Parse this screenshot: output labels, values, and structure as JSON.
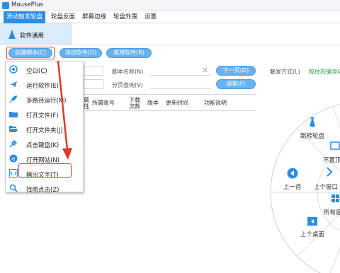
{
  "window": {
    "title": "MousePlus"
  },
  "menu": {
    "tabs": [
      {
        "label": "滑动触发轮盘"
      },
      {
        "label": "轮盘反面"
      },
      {
        "label": "屏幕边缘"
      },
      {
        "label": "轮盘外围"
      },
      {
        "label": "设置"
      }
    ]
  },
  "subnav": {
    "label": "软件通用"
  },
  "toolbar": {
    "create_label": "创建脚本(C)",
    "add_label": "添加软件(G)",
    "disable_label": "禁用软件(R)"
  },
  "filters": {
    "script_name_label": "脚本名称(N)",
    "page_query_label": "分页查询(V)",
    "next_page_label": "下一页(D)",
    "search_label": "搜索(F)",
    "trigger_label": "触发方式(L)",
    "trigger_value": "按住右键滑动"
  },
  "table": {
    "columns": [
      "属性",
      "所属账号",
      "下载次数",
      "版本",
      "更新时间",
      "功能说明"
    ]
  },
  "context_menu": {
    "items": [
      {
        "label": "空白(C)",
        "icon": "circle-dot-icon"
      },
      {
        "label": "运行软件(E)",
        "icon": "airplane-icon"
      },
      {
        "label": "多路径运行(M)",
        "icon": "rocket-icon"
      },
      {
        "label": "打开文件(F)",
        "icon": "folder-icon"
      },
      {
        "label": "打开文件夹(J)",
        "icon": "folder-open-icon"
      },
      {
        "label": "点击键盘(K)",
        "icon": "keyboard-icon"
      },
      {
        "label": "打开网站(N)",
        "icon": "ie-icon"
      },
      {
        "label": "输出文字(T)",
        "icon": "code-icon"
      },
      {
        "label": "找图点击(Z)",
        "icon": "search-icon"
      }
    ]
  },
  "dial": {
    "items": [
      {
        "label": "跳转轮盘",
        "icon": "tie-icon"
      },
      {
        "label": "不置顶",
        "icon": "pin-icon"
      },
      {
        "label": "上一首",
        "icon": "prev-icon"
      },
      {
        "label": "上个窗口",
        "icon": "window-icon"
      },
      {
        "label": "所有窗",
        "icon": "windows-icon"
      },
      {
        "label": "上个桌面",
        "icon": "desktop-icon"
      }
    ]
  },
  "colors": {
    "accent": "#2e8de0",
    "highlight": "#e0392a",
    "trigger_text": "#1f9b3f"
  }
}
